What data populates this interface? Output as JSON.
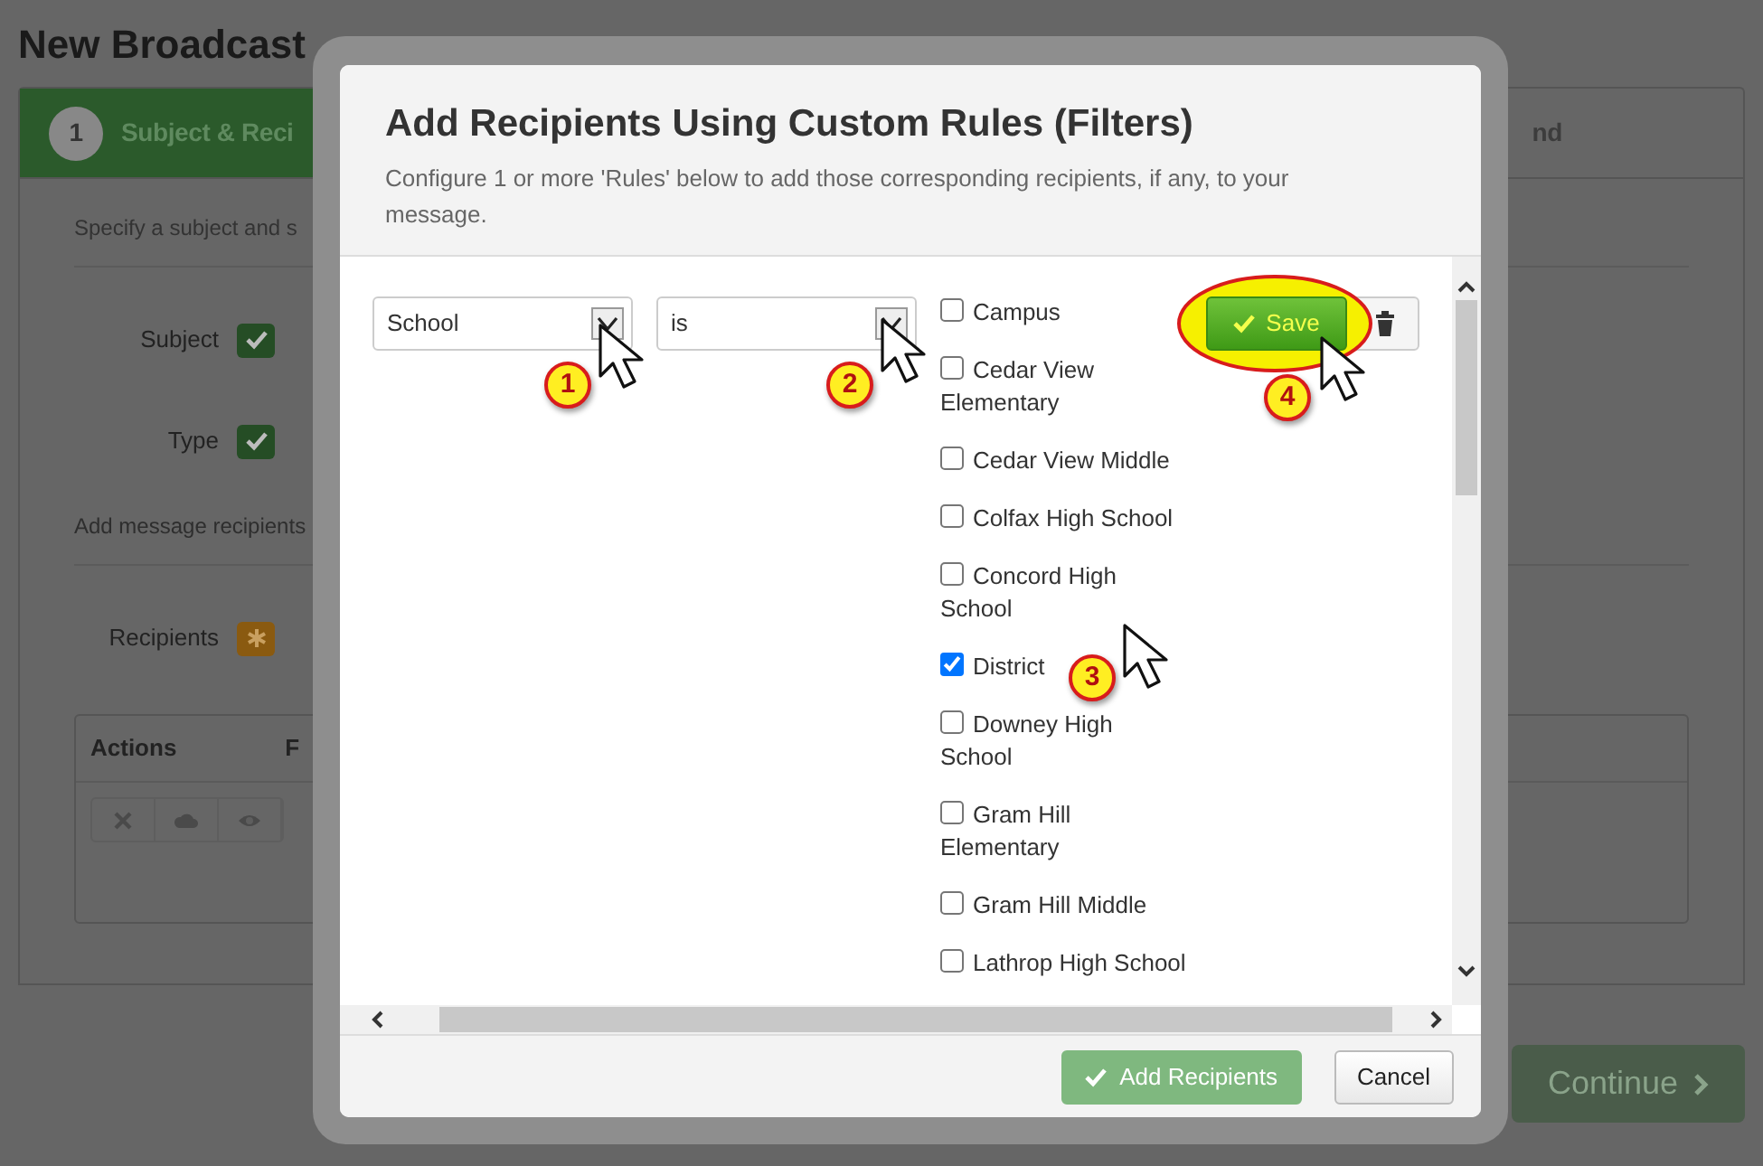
{
  "page": {
    "title": "New Broadcast",
    "steps": [
      {
        "number": "1",
        "label": "Subject & Reci",
        "selected": true
      },
      {
        "label": "nd",
        "selected": false
      }
    ],
    "intro": "Specify a subject and s",
    "fields": [
      {
        "label": "Subject",
        "complete": true
      },
      {
        "label": "Type",
        "complete": true
      }
    ],
    "recipients_hint": "Add message recipients",
    "recipients": {
      "label": "Recipients",
      "complete": false
    },
    "table": {
      "columns": [
        "Actions",
        "F"
      ]
    },
    "continue": "Continue"
  },
  "dialog": {
    "title": "Add Recipients Using Custom Rules (Filters)",
    "description": "Configure 1 or more 'Rules' below to add those corresponding recipients, if any, to your message.",
    "rule": {
      "field": "School",
      "operator": "is",
      "options": [
        {
          "label": "Campus",
          "checked": false
        },
        {
          "label": "Cedar View Elementary",
          "checked": false
        },
        {
          "label": "Cedar View Middle",
          "checked": false
        },
        {
          "label": "Colfax High School",
          "checked": false
        },
        {
          "label": "Concord High School",
          "checked": false
        },
        {
          "label": "District",
          "checked": true
        },
        {
          "label": "Downey High School",
          "checked": false
        },
        {
          "label": "Gram Hill Elementary",
          "checked": false
        },
        {
          "label": "Gram Hill Middle",
          "checked": false
        },
        {
          "label": "Lathrop High School",
          "checked": false
        }
      ],
      "save": {
        "label": "Save",
        "highlighted": true
      }
    },
    "buttons": [
      {
        "label": "Add Recipients",
        "kind": "primary",
        "disabled": true
      },
      {
        "label": "Cancel",
        "kind": "secondary",
        "disabled": false
      }
    ]
  },
  "callouts": [
    {
      "label": "1"
    },
    {
      "label": "2"
    },
    {
      "label": "3"
    },
    {
      "label": "4"
    }
  ]
}
